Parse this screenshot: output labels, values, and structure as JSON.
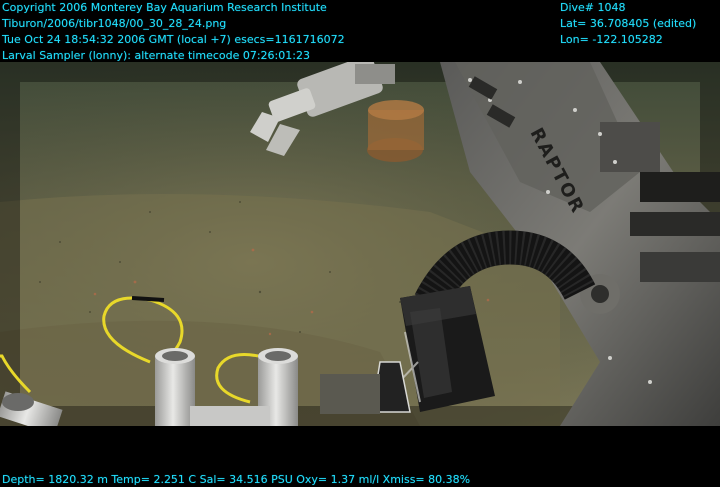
{
  "overlay": {
    "top_left": [
      "Copyright 2006 Monterey Bay Aquarium Research Institute",
      "Tiburon/2006/tibr1048/00_30_28_24.png",
      "Tue Oct 24 18:54:32 2006 GMT (local +7)  esecs=1161716072",
      "Larval Sampler (lonny): alternate timecode 07:26:01:23"
    ],
    "top_right": [
      "Dive# 1048",
      "Lat= 36.708405 (edited)",
      "Lon= -122.105282"
    ],
    "bottom": "Depth= 1820.32 m  Temp= 2.251 C  Sal= 34.516 PSU  Oxy= 1.37 ml/l  Xmiss= 80.38%"
  },
  "scene": {
    "manipulator_label": "RAPTOR",
    "overlay_color": "#22e0ff",
    "seafloor_color": "#6e6a4a"
  }
}
